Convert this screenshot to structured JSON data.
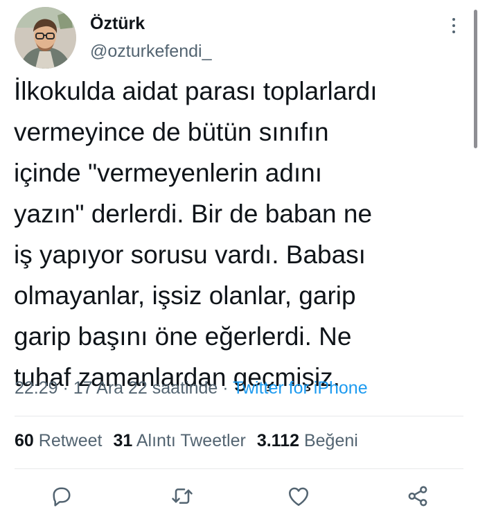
{
  "user": {
    "name": "Öztürk",
    "handle": "@ozturkefendi_"
  },
  "tweet": {
    "lines": [
      "İlkokulda aidat parası toplarlardı",
      "vermeyince de bütün sınıfın",
      "içinde \"vermeyenlerin adını",
      "yazın\" derlerdi. Bir de baban ne",
      "iş yapıyor sorusu vardı. Babası",
      "olmayanlar, işsiz olanlar, garip",
      "garip başını öne eğerlerdi. Ne",
      "tuhaf zamanlardan geçmişiz."
    ],
    "time": "22:29",
    "separator": "·",
    "date": "17 Ara 22 saatinde",
    "source": "Twitter for iPhone"
  },
  "stats": {
    "retweets_count": "60",
    "retweets_label": "Retweet",
    "quotes_count": "31",
    "quotes_label": "Alıntı Tweetler",
    "likes_count": "3.112",
    "likes_label": "Beğeni"
  },
  "icons": {
    "more": "more-vertical-icon",
    "reply": "reply-icon",
    "retweet": "retweet-icon",
    "like": "heart-icon",
    "share": "share-icon"
  },
  "colors": {
    "text": "#0f1419",
    "secondary": "#536471",
    "accent": "#1d9bf0",
    "divider": "#e7e9ea"
  }
}
